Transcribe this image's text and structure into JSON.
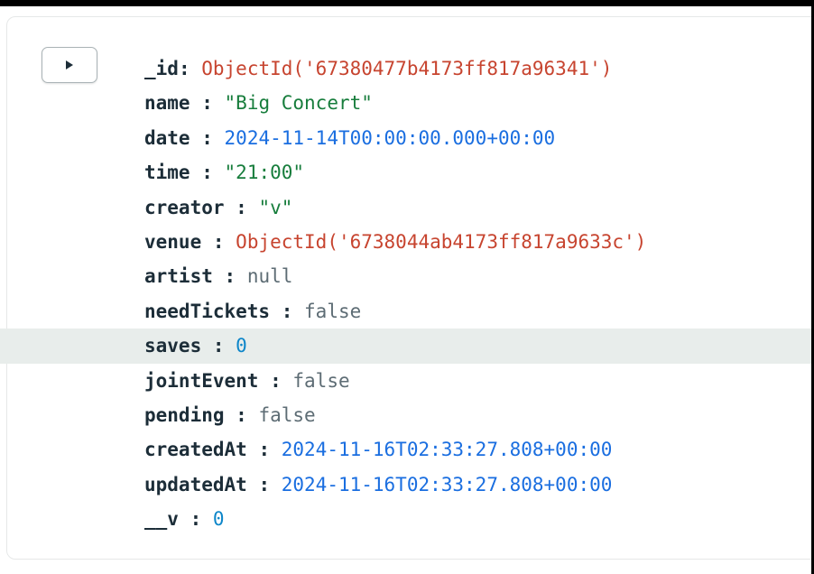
{
  "document": {
    "fields": [
      {
        "key": "_id",
        "sep": ":",
        "value": "ObjectId('67380477b4173ff817a96341')",
        "kind": "objectid"
      },
      {
        "key": "name",
        "sep": " :",
        "value": "\"Big Concert\"",
        "kind": "string"
      },
      {
        "key": "date",
        "sep": " :",
        "value": "2024-11-14T00:00:00.000+00:00",
        "kind": "date"
      },
      {
        "key": "time",
        "sep": " :",
        "value": "\"21:00\"",
        "kind": "string"
      },
      {
        "key": "creator",
        "sep": " :",
        "value": "\"v\"",
        "kind": "string"
      },
      {
        "key": "venue",
        "sep": " :",
        "value": "ObjectId('6738044ab4173ff817a9633c')",
        "kind": "objectid"
      },
      {
        "key": "artist",
        "sep": " :",
        "value": "null",
        "kind": "null"
      },
      {
        "key": "needTickets",
        "sep": " :",
        "value": "false",
        "kind": "boolean"
      },
      {
        "key": "saves",
        "sep": " :",
        "value": "0",
        "kind": "number"
      },
      {
        "key": "jointEvent",
        "sep": " :",
        "value": "false",
        "kind": "boolean"
      },
      {
        "key": "pending",
        "sep": " :",
        "value": "false",
        "kind": "boolean"
      },
      {
        "key": "createdAt",
        "sep": " :",
        "value": "2024-11-16T02:33:27.808+00:00",
        "kind": "date"
      },
      {
        "key": "updatedAt",
        "sep": " :",
        "value": "2024-11-16T02:33:27.808+00:00",
        "kind": "date"
      },
      {
        "key": "__v",
        "sep": " :",
        "value": "0",
        "kind": "number"
      }
    ]
  },
  "expand_button": {
    "icon": "triangle-right-icon"
  },
  "colors": {
    "key": "#1c2d38",
    "objectid": "#c7442f",
    "string": "#177d3c",
    "date": "#1a6ee0",
    "number": "#0d86c9",
    "plain": "#5d6c74",
    "row_highlight": "#e8edeb"
  }
}
